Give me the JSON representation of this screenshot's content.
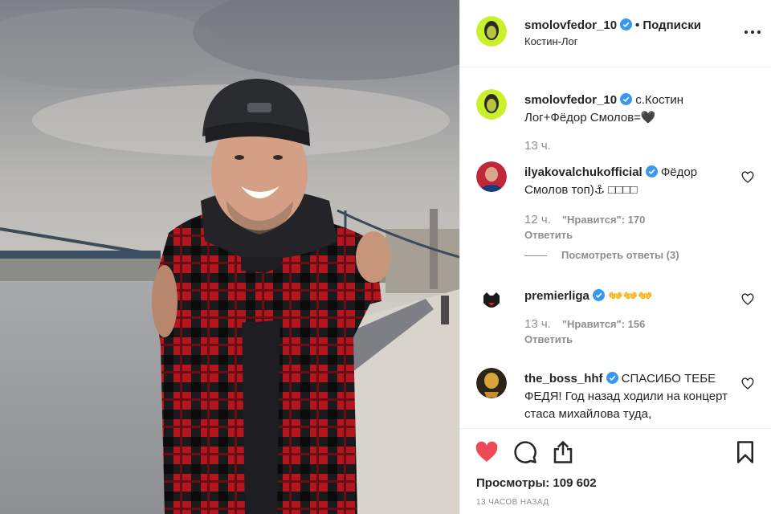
{
  "post": {
    "author": "smolovfedor_10",
    "separator": "•",
    "follow_label": "Подписки",
    "location": "Костин-Лог",
    "more_label": "..."
  },
  "comments": [
    {
      "user": "smolovfedor_10",
      "verified": true,
      "text": " с.Костин Лог+Фёдор Смолов=🖤",
      "time": "13 ч.",
      "likes": "",
      "reply": ""
    },
    {
      "user": "ilyakovalchukofficial",
      "verified": true,
      "text": " Фёдор Смолов топ)⚓ □□□□",
      "time": "12 ч.",
      "likes": "\"Нравится\": 170",
      "reply": "Ответить",
      "view_replies": "Посмотреть ответы (3)"
    },
    {
      "user": "premierliga",
      "verified": true,
      "text": " 👐👐👐",
      "time": "13 ч.",
      "likes": "\"Нравится\": 156",
      "reply": "Ответить"
    },
    {
      "user": "the_boss_hhf",
      "verified": true,
      "text": " СПАСИБО ТЕБЕ ФЕДЯ! Год назад ходили на концерт стаса михайлова туда,",
      "time": "",
      "likes": "",
      "reply": ""
    }
  ],
  "footer": {
    "views": "Просмотры: 109 602",
    "posted_ago": "13 часов назад"
  },
  "colors": {
    "like_red": "#ed4956",
    "verified_blue": "#3897f0",
    "muted": "#8e8e8e",
    "text": "#262626"
  },
  "icons": [
    "verified-icon",
    "heart-icon",
    "comment-icon",
    "share-icon",
    "bookmark-icon",
    "more-icon"
  ]
}
